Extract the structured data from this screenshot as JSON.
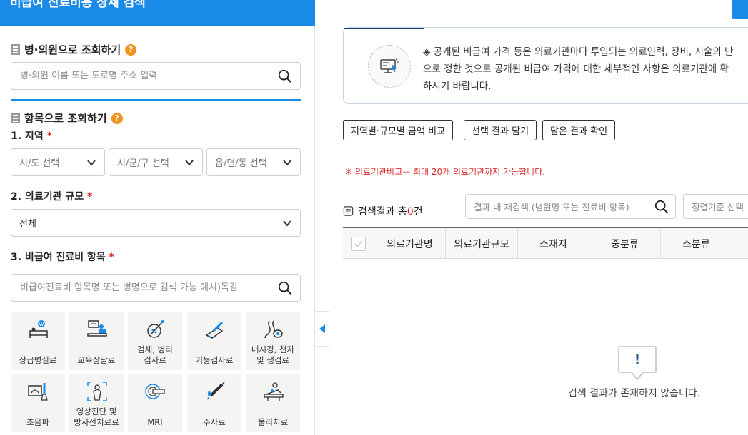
{
  "left": {
    "header": "비급여 진료비용 상세 검색",
    "hospital_section": {
      "title": "병·의원으로 조회하기",
      "help": "?",
      "placeholder": "병·의원 이름 또는 도로명 주소 입력"
    },
    "item_section": {
      "title": "항목으로 조회하기",
      "help": "?"
    },
    "region": {
      "label": "1. 지역",
      "required": "*",
      "selects": [
        "시/도 선택",
        "시/군/구 선택",
        "읍/면/동 선택"
      ]
    },
    "scale": {
      "label": "2. 의료기관 규모",
      "required": "*",
      "value": "전체"
    },
    "nonpay": {
      "label": "3. 비급여 진료비 항목",
      "required": "*",
      "placeholder": "비급여진료비 항목명 또는 병명으로 검색 가능 예시)독감"
    },
    "tiles": [
      {
        "icon": "bed-icon",
        "lines": [
          "상급병실료"
        ]
      },
      {
        "icon": "counseling-icon",
        "lines": [
          "교육상담료"
        ]
      },
      {
        "icon": "specimen-test-icon",
        "lines": [
          "검체, 병리",
          "검사료"
        ]
      },
      {
        "icon": "function-test-icon",
        "lines": [
          "기능검사료"
        ]
      },
      {
        "icon": "endoscope-icon",
        "lines": [
          "내시경, 천자",
          "및 생검료"
        ]
      },
      {
        "icon": "ultrasound-icon",
        "lines": [
          "초음파"
        ]
      },
      {
        "icon": "imaging-icon",
        "lines": [
          "영상진단 및",
          "방사선치료료"
        ]
      },
      {
        "icon": "mri-icon",
        "lines": [
          "MRI"
        ]
      },
      {
        "icon": "injection-icon",
        "lines": [
          "주사료"
        ]
      },
      {
        "icon": "physical-therapy-icon",
        "lines": [
          "물리치료"
        ]
      }
    ]
  },
  "right": {
    "notice": {
      "lines": [
        "◈ 공개된 비급여 가격 등은 의료기관마다 투입되는 의료인력, 장비, 시술의 난",
        "으로 정한 것으로 공개된 비급여 가격에 대한 세부적인 사항은 의료기관에 확",
        "하시기 바랍니다."
      ]
    },
    "buttons": [
      "지역별·규모별 금액 비교",
      "선택 결과 담기",
      "담은 결과 확인"
    ],
    "warning": "※ 의료기관비교는 최대 20개 의료기관까지 가능합니다.",
    "result": {
      "prefix": "검색결과 총",
      "count": "0",
      "suffix": "건"
    },
    "research_placeholder": "결과 내 재검색 (병원명 또는 진료비 항목)",
    "sort_placeholder": "정렬기준 선택",
    "columns": [
      "의료기관명",
      "의료기관규모",
      "소재지",
      "중분류",
      "소분류"
    ],
    "empty_text": "검색 결과가 존재하지 않습니다.",
    "empty_icon_symbol": "!"
  }
}
